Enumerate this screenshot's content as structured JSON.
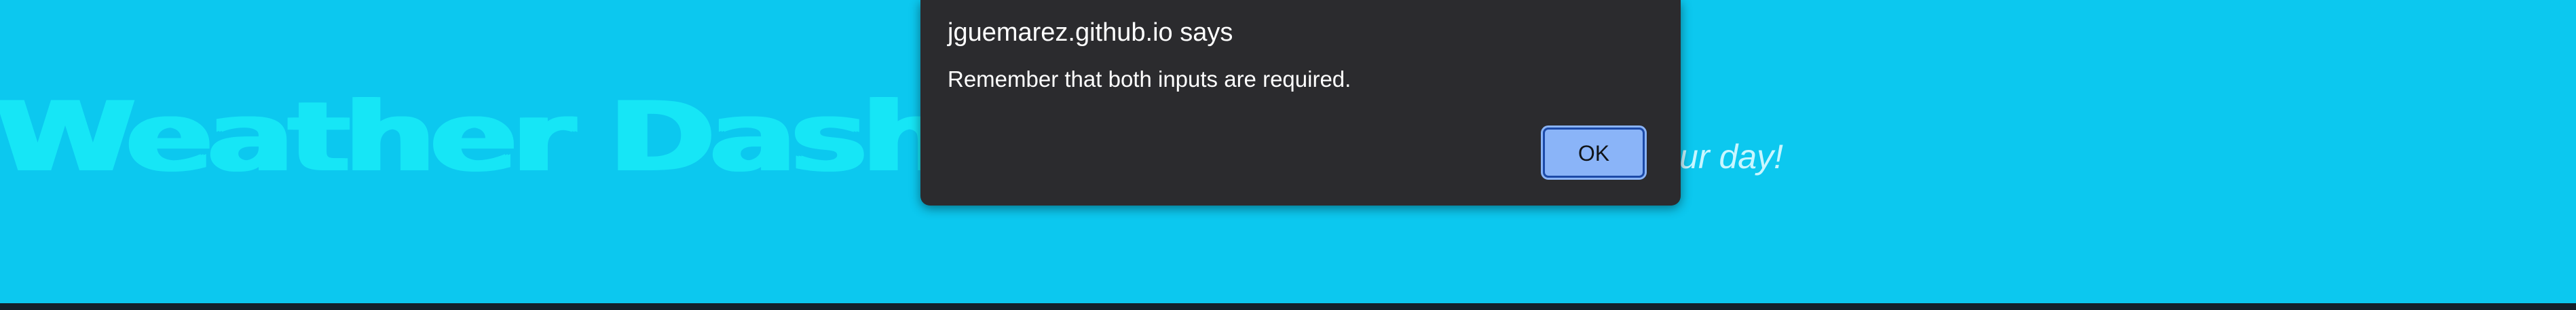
{
  "page": {
    "title": "Weather Dashboard",
    "tagline": "how to spend your day!"
  },
  "dialog": {
    "origin": "jguemarez.github.io says",
    "message": "Remember that both inputs are required.",
    "ok_label": "OK"
  },
  "colors": {
    "background": "#0cc8ef",
    "title": "#16e6f6",
    "tagline": "#c9f6ff",
    "dialog_bg": "#2b2b2e",
    "button_bg": "#8ab4f8",
    "bottom_bar": "#14212b"
  }
}
